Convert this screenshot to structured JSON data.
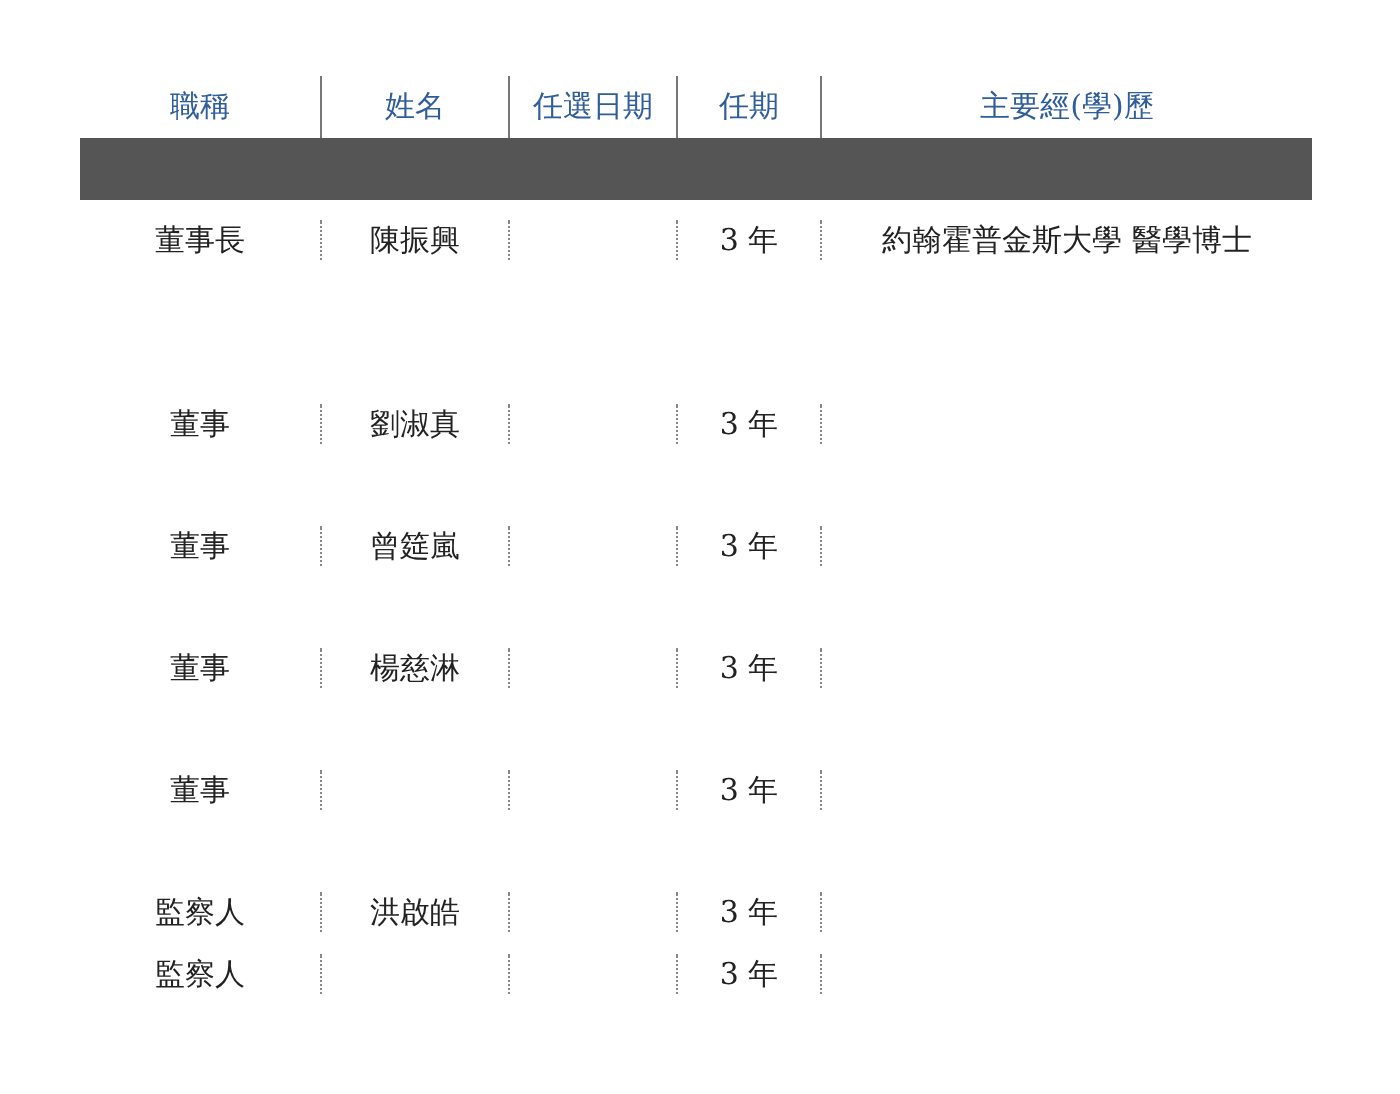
{
  "table": {
    "columns": [
      "職稱",
      "姓名",
      "任選日期",
      "任期",
      "主要經(學)歷"
    ],
    "rows": [
      {
        "title": "董事長",
        "name": "陳振興",
        "term": "3 年",
        "education": "約翰霍普金斯大學  醫學博士"
      },
      {
        "title": "董事",
        "name": "劉淑真",
        "term": "3 年"
      },
      {
        "title": "董事",
        "name": "曾筵嵐",
        "term": "3 年"
      },
      {
        "title": "董事",
        "name": "楊慈淋",
        "term": "3 年"
      },
      {
        "title": "董事",
        "term": "3 年"
      },
      {
        "title": "監察人",
        "name": "洪啟皓",
        "term": "3 年"
      },
      {
        "title": "監察人",
        "term": "3 年"
      }
    ]
  }
}
